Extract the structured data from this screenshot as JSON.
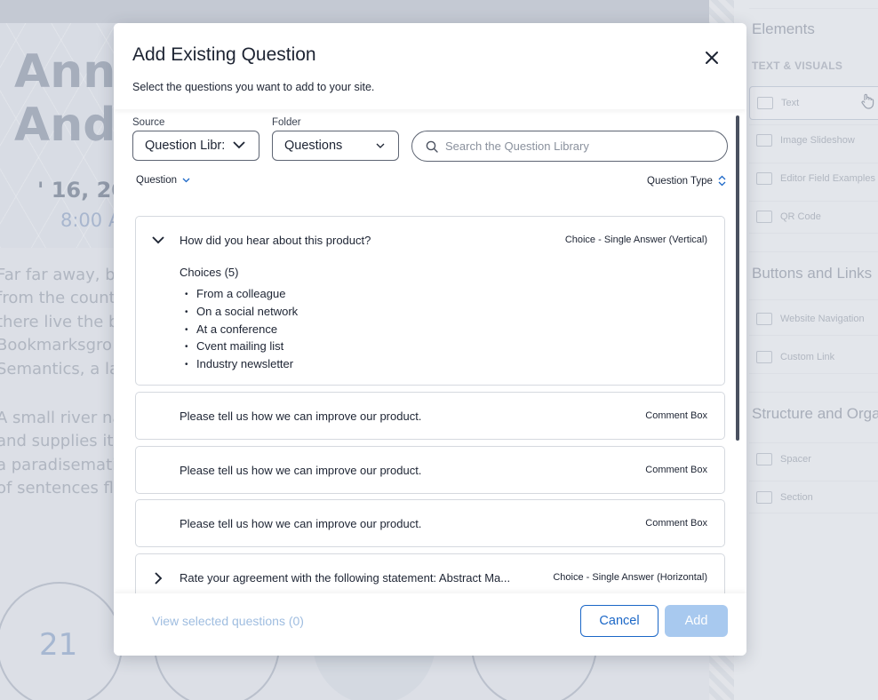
{
  "background": {
    "title_line1": "Annu",
    "title_line2": "And",
    "date": "' 16, 20",
    "time": "8:00 A",
    "para1": [
      "Far far away, b",
      "from the count",
      "there live the b",
      "Bookmarksgro",
      "Semantics, a la"
    ],
    "para2": [
      "A small river na",
      "and supplies it",
      "a paradisemati",
      "of sentences fly"
    ],
    "circle_number": "21"
  },
  "sidebar": {
    "heading_elements": "Elements",
    "sub_text_visuals": "TEXT & VISUALS",
    "items_text_visuals": [
      "Text",
      "Image Slideshow",
      "Editor Field Examples",
      "QR Code"
    ],
    "heading_buttons": "Buttons and Links",
    "items_buttons": [
      "Website Navigation",
      "Custom Link"
    ],
    "heading_structure": "Structure and Orga",
    "items_structure": [
      "Spacer",
      "Section"
    ]
  },
  "modal": {
    "title": "Add Existing Question",
    "subtitle": "Select the questions you want to add to your site.",
    "source_label": "Source",
    "source_value": "Question Libr:",
    "folder_label": "Folder",
    "folder_value": "Questions",
    "search_placeholder": "Search the Question Library",
    "col_question": "Question",
    "col_type": "Question Type",
    "questions": [
      {
        "text": "How did you hear about this product?",
        "type": "Choice - Single Answer (Vertical)",
        "expanded": true,
        "choices_label": "Choices (5)",
        "choices": [
          "From a colleague",
          "On a social network",
          "At a conference",
          "Cvent mailing list",
          "Industry newsletter"
        ]
      },
      {
        "text": "Please tell us how we can improve our product.",
        "type": "Comment Box"
      },
      {
        "text": "Please tell us how we can improve our product.",
        "type": "Comment Box"
      },
      {
        "text": "Please tell us how we can improve our product.",
        "type": "Comment Box"
      },
      {
        "text": "Rate your agreement with the following statement: Abstract Ma...",
        "type": "Choice - Single Answer (Horizontal)",
        "expanded": false
      }
    ],
    "view_selected": "View selected questions (0)",
    "cancel": "Cancel",
    "add": "Add"
  },
  "colors": {
    "primary": "#1b67c7",
    "primary_disabled": "#a8c9ef",
    "text": "#1d2433"
  }
}
